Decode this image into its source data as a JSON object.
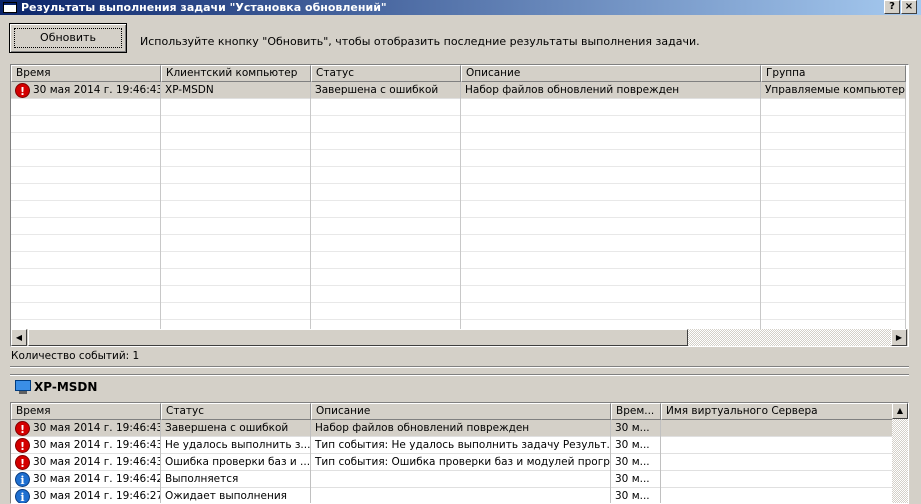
{
  "window": {
    "title": "Результаты выполнения задачи \"Установка обновлений\"",
    "help_label": "?",
    "close_label": "×"
  },
  "toolbar": {
    "refresh_label": "Обновить",
    "hint": "Используйте кнопку \"Обновить\", чтобы отобразить последние результаты выполнения задачи."
  },
  "grid1": {
    "columns": [
      "Время",
      "Клиентский компьютер",
      "Статус",
      "Описание",
      "Группа"
    ],
    "rows": [
      {
        "icon": "error-icon",
        "cells": [
          "30 мая 2014 г. 19:46:43",
          "XP-MSDN",
          "Завершена с ошибкой",
          "Набор файлов обновлений поврежден",
          "Управляемые компьютеры"
        ]
      }
    ]
  },
  "status": {
    "count_label": "Количество событий: 1"
  },
  "details": {
    "client_icon": "computer-icon",
    "client_name": "XP-MSDN",
    "columns": [
      "Время",
      "Статус",
      "Описание",
      "Врем...",
      "Имя виртуального Сервера"
    ],
    "rows": [
      {
        "icon": "error-icon",
        "cells": [
          "30 мая 2014 г. 19:46:43",
          "Завершена с ошибкой",
          "Набор файлов обновлений поврежден",
          "30 м...",
          ""
        ]
      },
      {
        "icon": "error-icon",
        "cells": [
          "30 мая 2014 г. 19:46:43",
          "Не удалось выполнить з...",
          "Тип события: Не удалось выполнить задачу Результ...",
          "30 м...",
          ""
        ]
      },
      {
        "icon": "error-icon",
        "cells": [
          "30 мая 2014 г. 19:46:43",
          "Ошибка проверки баз и ...",
          "Тип события: Ошибка проверки баз и модулей програ...",
          "30 м...",
          ""
        ]
      },
      {
        "icon": "info-icon",
        "cells": [
          "30 мая 2014 г. 19:46:42",
          "Выполняется",
          "",
          "30 м...",
          ""
        ]
      },
      {
        "icon": "info-icon",
        "cells": [
          "30 мая 2014 г. 19:46:27",
          "Ожидает выполнения",
          "",
          "30 м...",
          ""
        ]
      }
    ]
  },
  "colors": {
    "window_bg": "#d4d0c8",
    "title_bar": "#0a246a",
    "error": "#d40000",
    "info": "#1e6fd0"
  }
}
